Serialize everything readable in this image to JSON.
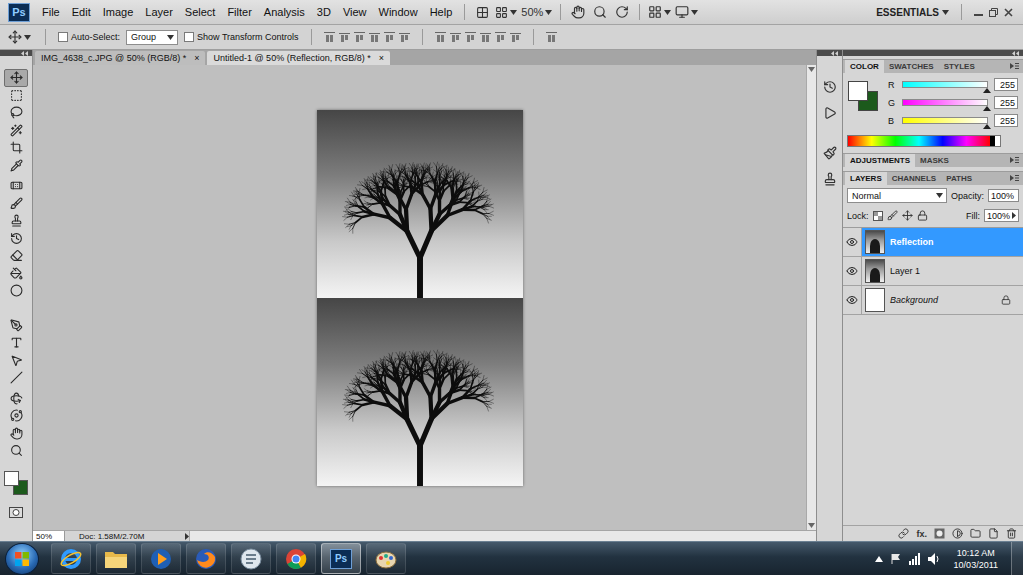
{
  "app": {
    "logo": "Ps",
    "menus": [
      "File",
      "Edit",
      "Image",
      "Layer",
      "Select",
      "Filter",
      "Analysis",
      "3D",
      "View",
      "Window",
      "Help"
    ],
    "zoom": "50%",
    "workspace": "ESSENTIALS"
  },
  "options_bar": {
    "auto_select": {
      "label": "Auto-Select:",
      "checked": false
    },
    "target": "Group",
    "transform_controls": {
      "label": "Show Transform Controls",
      "checked": false
    }
  },
  "tools": [
    {
      "kind": "move",
      "selected": true
    },
    {
      "kind": "marquee",
      "selected": false
    },
    {
      "kind": "lasso",
      "selected": false
    },
    {
      "kind": "magic-wand",
      "selected": false
    },
    {
      "kind": "crop",
      "selected": false
    },
    {
      "kind": "eyedropper",
      "selected": false
    },
    {
      "kind": "healing",
      "selected": false
    },
    {
      "kind": "brush",
      "selected": false
    },
    {
      "kind": "clone-stamp",
      "selected": false
    },
    {
      "kind": "history-brush",
      "selected": false
    },
    {
      "kind": "eraser",
      "selected": false
    },
    {
      "kind": "paint-bucket",
      "selected": false
    },
    {
      "kind": "dodge",
      "selected": false
    },
    {
      "kind": "pen",
      "selected": false
    },
    {
      "kind": "type",
      "selected": false
    },
    {
      "kind": "path-selection",
      "selected": false
    },
    {
      "kind": "line",
      "selected": false
    },
    {
      "kind": "rotate-3d",
      "selected": false
    },
    {
      "kind": "orbit-3d",
      "selected": false
    },
    {
      "kind": "hand",
      "selected": false
    },
    {
      "kind": "zoom",
      "selected": false
    }
  ],
  "colors": {
    "foreground": "#ffffff",
    "background": "#1c5a1c"
  },
  "documents": [
    {
      "label": "IMG_4638_c.JPG @ 50% (RGB/8) *",
      "close": "×",
      "selected": false
    },
    {
      "label": "Untitled-1 @ 50% (Reflection, RGB/8) *",
      "close": "×",
      "selected": true
    }
  ],
  "status_bar": {
    "zoom": "50%",
    "doc": "Doc: 1.58M/2.70M"
  },
  "color_panel": {
    "tabs": [
      {
        "label": "COLOR",
        "selected": true
      },
      {
        "label": "SWATCHES",
        "selected": false
      },
      {
        "label": "STYLES",
        "selected": false
      }
    ],
    "channels": [
      {
        "name": "R",
        "value": "255",
        "level": 1,
        "color": "#00ffff"
      },
      {
        "name": "G",
        "value": "255",
        "level": 1,
        "color": "#ff00ff"
      },
      {
        "name": "B",
        "value": "255",
        "level": 1,
        "color": "#ffff00"
      }
    ]
  },
  "adjustments_panel": {
    "tabs": [
      {
        "label": "ADJUSTMENTS",
        "selected": true
      },
      {
        "label": "MASKS",
        "selected": false
      }
    ]
  },
  "layers_panel": {
    "tabs": [
      {
        "label": "LAYERS",
        "selected": true
      },
      {
        "label": "CHANNELS",
        "selected": false
      },
      {
        "label": "PATHS",
        "selected": false
      }
    ],
    "blend_mode": "Normal",
    "opacity_label": "Opacity:",
    "opacity": "100%",
    "lock_label": "Lock:",
    "fill_label": "Fill:",
    "fill": "100%",
    "effects_label": "fx.",
    "layers": [
      {
        "name": "Reflection",
        "kind": "image",
        "selected": true,
        "visible": true
      },
      {
        "name": "Layer 1",
        "kind": "image",
        "selected": false,
        "visible": true
      },
      {
        "name": "Background",
        "kind": "background",
        "selected": false,
        "visible": true
      }
    ]
  },
  "taskbar": {
    "apps": [
      {
        "kind": "internet-explorer",
        "selected": false
      },
      {
        "kind": "explorer",
        "selected": false
      },
      {
        "kind": "media-player",
        "selected": false
      },
      {
        "kind": "firefox",
        "selected": false
      },
      {
        "kind": "messenger",
        "selected": false
      },
      {
        "kind": "chrome",
        "selected": false
      },
      {
        "kind": "photoshop",
        "label": "Ps",
        "selected": true
      },
      {
        "kind": "paint",
        "selected": false
      }
    ],
    "time": "10:12 AM",
    "date": "10/03/2011"
  }
}
